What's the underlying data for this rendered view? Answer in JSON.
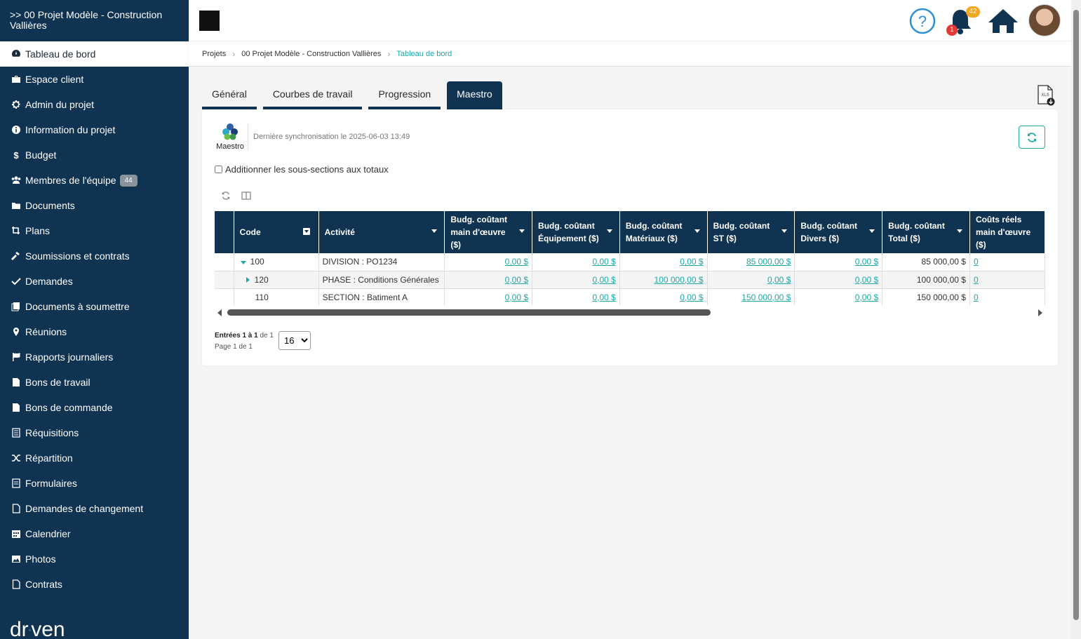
{
  "project": {
    "title": ">> 00 Projet Modèle - Construction Vallières"
  },
  "sidebar": {
    "items": [
      {
        "label": "Tableau de bord",
        "icon": "dashboard-icon",
        "active": true
      },
      {
        "label": "Espace client",
        "icon": "briefcase-icon"
      },
      {
        "label": "Admin du projet",
        "icon": "gear-icon"
      },
      {
        "label": "Information du projet",
        "icon": "info-icon"
      },
      {
        "label": "Budget",
        "icon": "dollar-icon"
      },
      {
        "label": "Membres de l'équipe",
        "icon": "users-icon",
        "badge": "44"
      },
      {
        "label": "Documents",
        "icon": "folder-icon"
      },
      {
        "label": "Plans",
        "icon": "crop-icon"
      },
      {
        "label": "Soumissions et contrats",
        "icon": "hammer-icon"
      },
      {
        "label": "Demandes",
        "icon": "check-icon"
      },
      {
        "label": "Documents à soumettre",
        "icon": "copy-icon"
      },
      {
        "label": "Réunions",
        "icon": "map-pin-icon"
      },
      {
        "label": "Rapports journaliers",
        "icon": "flag-icon"
      },
      {
        "label": "Bons de travail",
        "icon": "file-icon"
      },
      {
        "label": "Bons de commande",
        "icon": "file-icon"
      },
      {
        "label": "Réquisitions",
        "icon": "list-icon"
      },
      {
        "label": "Répartition",
        "icon": "shuffle-icon"
      },
      {
        "label": "Formulaires",
        "icon": "form-icon"
      },
      {
        "label": "Demandes de changement",
        "icon": "file-outline-icon"
      },
      {
        "label": "Calendrier",
        "icon": "calendar-icon"
      },
      {
        "label": "Photos",
        "icon": "image-icon"
      },
      {
        "label": "Contrats",
        "icon": "file-outline-icon"
      }
    ],
    "brand": "dr ven"
  },
  "header": {
    "notifications_count": "42",
    "alerts_count": "1"
  },
  "breadcrumb": [
    "Projets",
    "00 Projet Modèle - Construction Vallières",
    "Tableau de bord"
  ],
  "tabs": [
    {
      "label": "Général"
    },
    {
      "label": "Courbes de travail"
    },
    {
      "label": "Progression"
    },
    {
      "label": "Maestro",
      "active": true
    }
  ],
  "maestro": {
    "logo_label": "Maestro",
    "sync_text": "Dernière synchronisation le 2025-06-03 13:49",
    "checkbox_label": "Additionner les sous-sections aux totaux"
  },
  "table": {
    "columns": [
      "Code",
      "Activité",
      "Budg. coûtant main d'œuvre ($)",
      "Budg. coûtant Équipement ($)",
      "Budg. coûtant Matériaux ($)",
      "Budg. coûtant ST ($)",
      "Budg. coûtant Divers ($)",
      "Budg. coûtant Total ($)",
      "Coûts réels main d'œuvre ($)"
    ],
    "rows": [
      {
        "code": "100",
        "activity": "DIVISION : PO1234",
        "mo": "0,00 $",
        "eq": "0,00 $",
        "mat": "0,00 $",
        "st": "85 000,00 $",
        "div": "0,00 $",
        "total": "85 000,00 $",
        "reel": "0"
      },
      {
        "code": "120",
        "activity": "PHASE : Conditions Générales",
        "mo": "0,00 $",
        "eq": "0,00 $",
        "mat": "100 000,00 $",
        "st": "0,00 $",
        "div": "0,00 $",
        "total": "100 000,00 $",
        "reel": "0"
      },
      {
        "code": "110",
        "activity": "SECTION : Batiment A",
        "mo": "0,00 $",
        "eq": "0,00 $",
        "mat": "0,00 $",
        "st": "150 000,00 $",
        "div": "0,00 $",
        "total": "150 000,00 $",
        "reel": "0"
      }
    ]
  },
  "pager": {
    "entries_label": "Entrées",
    "entries_range": "1 à 1",
    "entries_of": "de 1",
    "page_text": "Page 1 de 1",
    "page_size": "16"
  },
  "colors": {
    "navy": "#0f3350",
    "teal": "#1ea7a7"
  }
}
